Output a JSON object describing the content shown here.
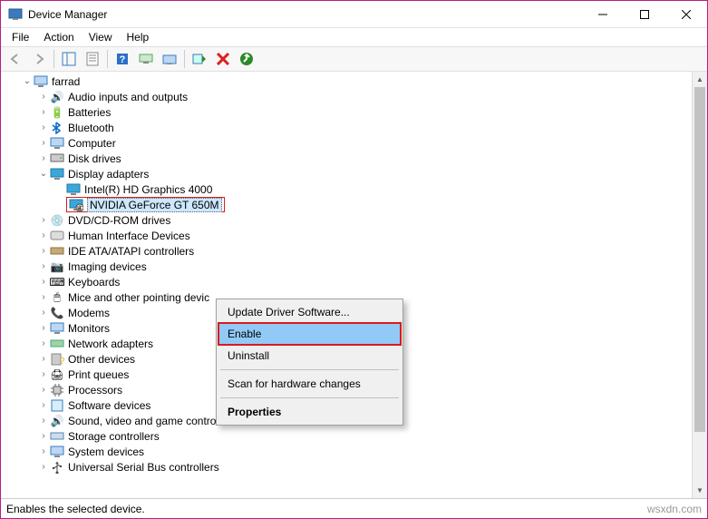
{
  "window": {
    "title": "Device Manager"
  },
  "menu": {
    "file": "File",
    "action": "Action",
    "view": "View",
    "help": "Help"
  },
  "tree": {
    "root": "farrad",
    "items": {
      "audio": "Audio inputs and outputs",
      "batteries": "Batteries",
      "bluetooth": "Bluetooth",
      "computer": "Computer",
      "disk": "Disk drives",
      "display": "Display adapters",
      "intel": "Intel(R) HD Graphics 4000",
      "nvidia": "NVIDIA GeForce GT 650M",
      "dvd": "DVD/CD-ROM drives",
      "hid": "Human Interface Devices",
      "ide": "IDE ATA/ATAPI controllers",
      "imaging": "Imaging devices",
      "keyboards": "Keyboards",
      "mice": "Mice and other pointing devic",
      "modems": "Modems",
      "monitors": "Monitors",
      "network": "Network adapters",
      "other": "Other devices",
      "printq": "Print queues",
      "processors": "Processors",
      "software": "Software devices",
      "sound": "Sound, video and game controllers",
      "storage": "Storage controllers",
      "system": "System devices",
      "usb": "Universal Serial Bus controllers"
    }
  },
  "context_menu": {
    "update": "Update Driver Software...",
    "enable": "Enable",
    "uninstall": "Uninstall",
    "scan": "Scan for hardware changes",
    "properties": "Properties"
  },
  "status": {
    "text": "Enables the selected device.",
    "watermark": "wsxdn.com"
  }
}
